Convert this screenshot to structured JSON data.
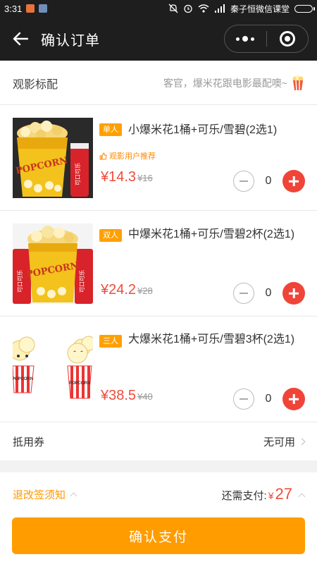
{
  "status_bar": {
    "time": "3:31",
    "carrier": "秦子恒微信课堂"
  },
  "nav": {
    "title": "确认订单"
  },
  "section": {
    "title": "观影标配",
    "tip": "客官，爆米花跟电影最配噢~"
  },
  "items": [
    {
      "tag": "单人",
      "name": "小爆米花1桶+可乐/雪碧(2选1)",
      "recommend": "观影用户推荐",
      "price": "¥14.3",
      "old_price": "¥16",
      "qty": "0"
    },
    {
      "tag": "双人",
      "name": "中爆米花1桶+可乐/雪碧2杯(2选1)",
      "price": "¥24.2",
      "old_price": "¥28",
      "qty": "0"
    },
    {
      "tag": "三人",
      "name": "大爆米花1桶+可乐/雪碧3杯(2选1)",
      "price": "¥38.5",
      "old_price": "¥40",
      "qty": "0"
    }
  ],
  "coupon": {
    "label": "抵用券",
    "value": "无可用"
  },
  "footer": {
    "notice": "退改签须知",
    "need_label": "还需支付:",
    "currency": "¥",
    "amount": "27",
    "confirm": "确认支付"
  },
  "image_text": {
    "popcorn": "POPCORN",
    "cola": "可口可乐"
  },
  "colors": {
    "accent": "#ff9c00",
    "price": "#f04b3a",
    "plus": "#f04438",
    "tag": "#ffa000"
  }
}
